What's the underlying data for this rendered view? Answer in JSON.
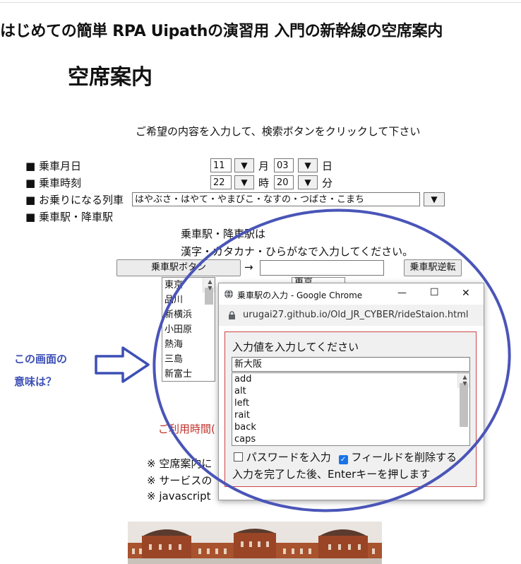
{
  "site": {
    "title": "はじめての簡単 RPA Uipathの演習用 入門の新幹線の空席案内"
  },
  "page": {
    "heading": "空席案内",
    "instruction": "ご希望の内容を入力して、検索ボタンをクリックして下さい"
  },
  "form": {
    "bullet": "■",
    "date_label": "乗車月日",
    "month_value": "11",
    "month_unit": "月",
    "day_value": "03",
    "day_unit": "日",
    "time_label": "乗車時刻",
    "hour_value": "22",
    "hour_unit": "時",
    "minute_value": "20",
    "minute_unit": "分",
    "train_label": "お乗りになる列車",
    "train_value": "はやぶさ・はやて・やまびこ・なすの・つばさ・こまち",
    "station_label": "乗車駅・降車駅",
    "dropdown_glyph": "▼",
    "station_note_1": "乗車駅・降車駅は",
    "station_note_2": "漢字・カタカナ・ひらがなで入力してください。",
    "ride_station_button": "乗車駅ボタン",
    "arrow": "→",
    "arrival_value": "",
    "reverse_button": "乗車駅逆転",
    "station_list": [
      "東京",
      "品川",
      "新横浜",
      "小田原",
      "熱海",
      "三島",
      "新富士"
    ],
    "arrival_list_top": "東京",
    "usage_time_partial": "ご利用時間(",
    "notes": [
      "※ 空席案内に",
      "※ サービスの",
      "※ javascript"
    ]
  },
  "annotation": {
    "question_line1": "この画面の",
    "question_line2": "意味は？",
    "arrow_color": "#3c4fb5",
    "circle_color": "#4a55b8"
  },
  "popup": {
    "window_title": "乗車駅の入力 - Google Chrome",
    "url": "urugai27.github.io/Old_JR_CYBER/rideStaion.html",
    "prompt_label": "入力値を入力してください",
    "input_value": "新大阪",
    "options": [
      "add",
      "alt",
      "left",
      "rait",
      "back",
      "caps"
    ],
    "password_label": "パスワードを入力",
    "password_checked": false,
    "clear_label": "フィールドを削除する",
    "clear_checked": true,
    "footer": "入力を完了した後、Enterキーを押します",
    "minimize_glyph": "—",
    "maximize_glyph": "☐",
    "close_glyph": "✕"
  }
}
